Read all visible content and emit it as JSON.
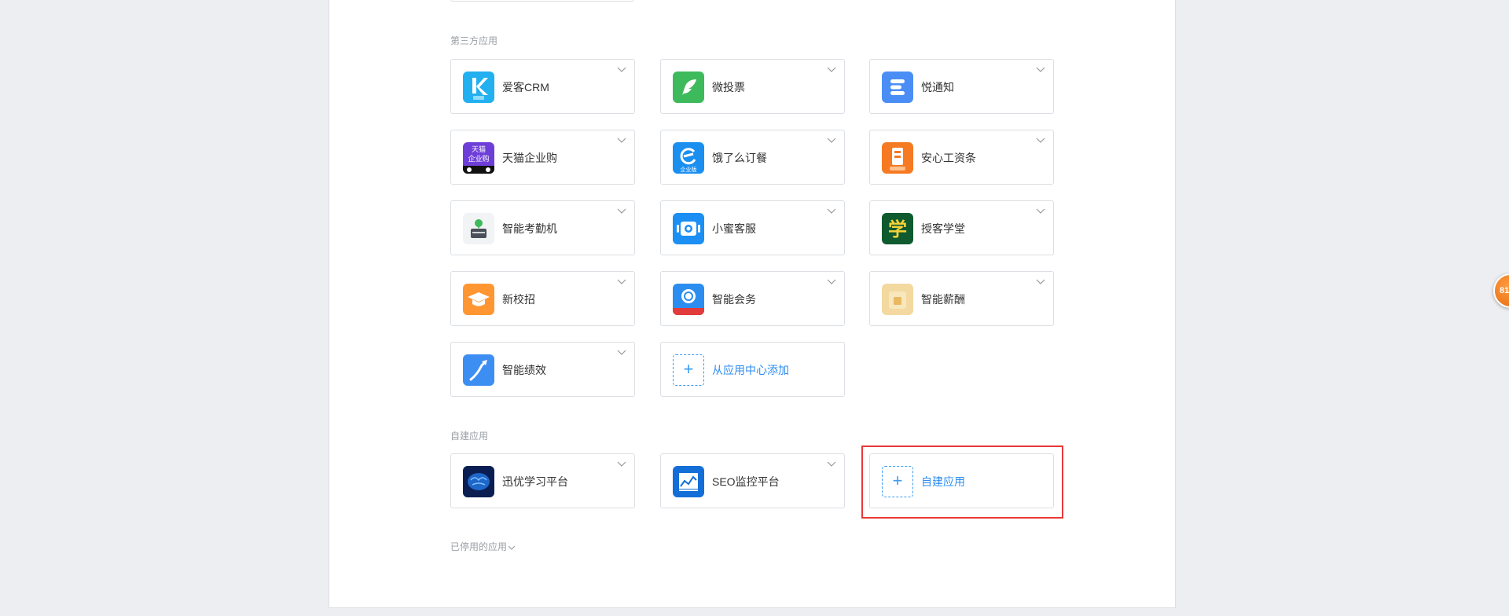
{
  "sections": {
    "third_party": {
      "title": "第三方应用",
      "apps": [
        {
          "name": "爱客CRM",
          "icon": "aike-crm-icon"
        },
        {
          "name": "微投票",
          "icon": "vote-icon"
        },
        {
          "name": "悦通知",
          "icon": "notice-icon"
        },
        {
          "name": "天猫企业购",
          "icon": "tmall-icon",
          "icon_text_1": "天猫",
          "icon_text_2": "企业购"
        },
        {
          "name": "饿了么订餐",
          "icon": "eleme-icon",
          "icon_text": "企业版"
        },
        {
          "name": "安心工资条",
          "icon": "payslip-icon"
        },
        {
          "name": "智能考勤机",
          "icon": "attendance-machine-icon"
        },
        {
          "name": "小蜜客服",
          "icon": "customer-service-icon"
        },
        {
          "name": "授客学堂",
          "icon": "school-icon",
          "icon_text": "学"
        },
        {
          "name": "新校招",
          "icon": "graduation-cap-icon"
        },
        {
          "name": "智能会务",
          "icon": "conference-icon"
        },
        {
          "name": "智能薪酬",
          "icon": "salary-icon"
        },
        {
          "name": "智能绩效",
          "icon": "performance-icon"
        }
      ],
      "add_label": "从应用中心添加"
    },
    "custom": {
      "title": "自建应用",
      "apps": [
        {
          "name": "迅优学习平台",
          "icon": "brain-icon"
        },
        {
          "name": "SEO监控平台",
          "icon": "chart-monitor-icon"
        }
      ],
      "add_label": "自建应用"
    },
    "disabled": {
      "title": "已停用的应用"
    }
  },
  "float_badge": {
    "text": "81"
  },
  "colors": {
    "accent": "#2d8cf0",
    "highlight": "#e8393a",
    "background": "#eceef1"
  }
}
